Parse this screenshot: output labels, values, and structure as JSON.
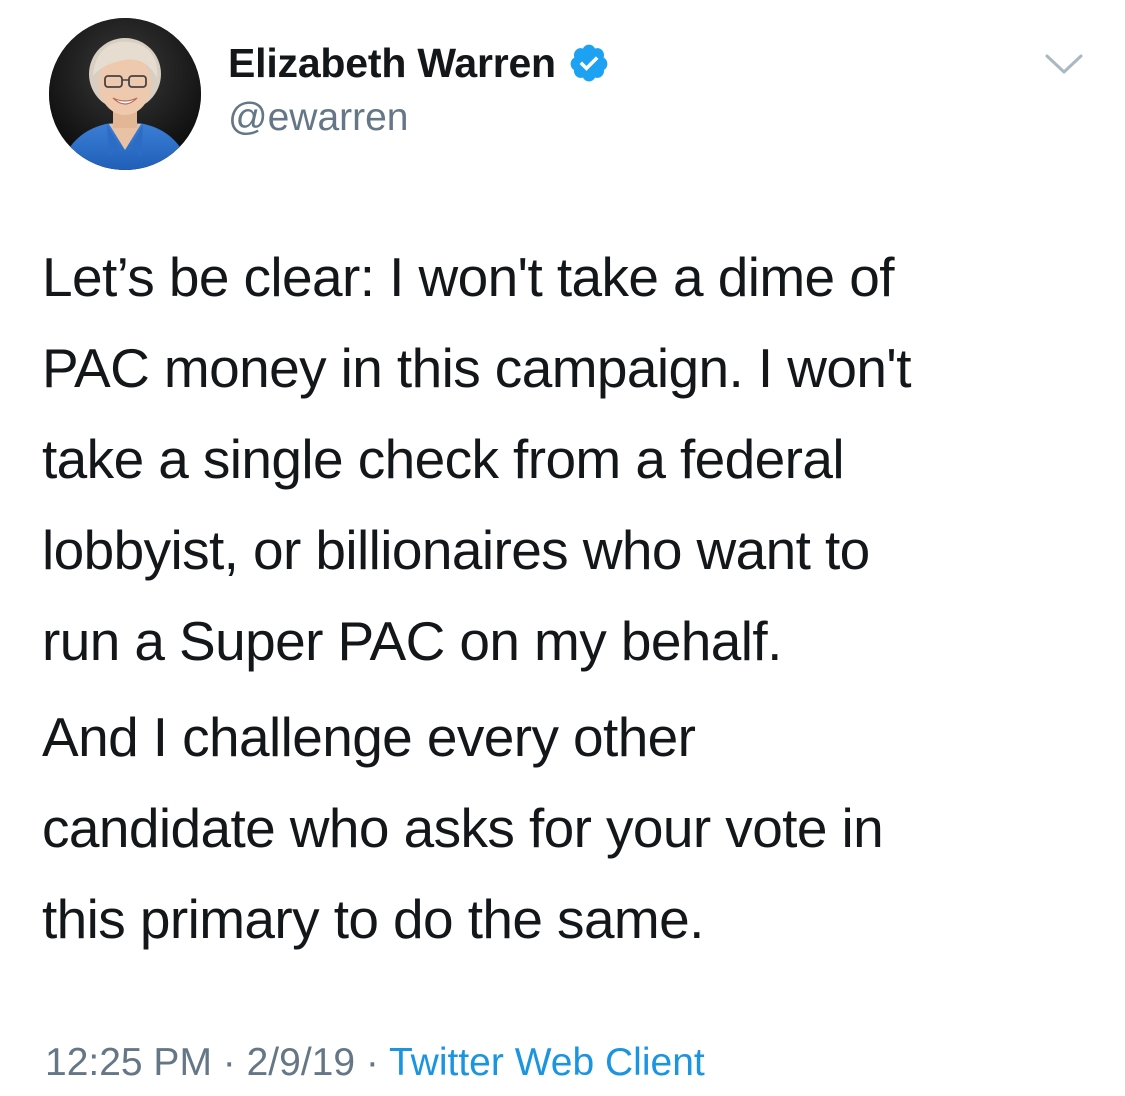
{
  "author": {
    "display_name": "Elizabeth Warren",
    "handle": "@ewarren",
    "verified": true,
    "avatar_description": "profile-photo"
  },
  "tweet": {
    "paragraphs": [
      "Let’s be clear: I won't take a dime of\nPAC money in this campaign. I won't\ntake a single check from a federal\nlobbyist, or billionaires who want to\nrun a Super PAC on my behalf.",
      "And I challenge every other\ncandidate who asks for your vote in\nthis primary to do the same."
    ]
  },
  "meta": {
    "time": "12:25 PM",
    "separator": " · ",
    "date": "2/9/19",
    "source": "Twitter Web Client"
  },
  "icons": {
    "caret": "chevron-down-icon",
    "verified": "verified-badge-icon"
  },
  "colors": {
    "text_primary": "#14171a",
    "text_secondary": "#657786",
    "accent": "#1b95e0",
    "verified_badge": "#1da1f2"
  }
}
